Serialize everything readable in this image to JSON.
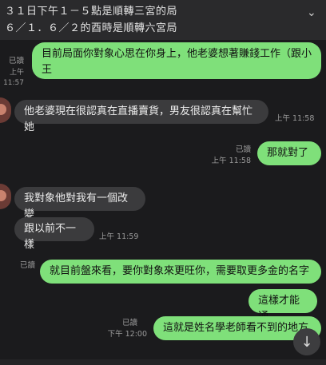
{
  "header": {
    "line1": "３１日下午１－５點是順轉三宮的局",
    "line2": "６／１．６／２的酉時是順轉六宮局"
  },
  "messages": [
    {
      "text": "目前局面你對象心思在你身上，他老婆想著賺錢工作（跟小王",
      "read": "已讀",
      "time": "上午 11:57"
    },
    {
      "text": "他老婆現在很認真在直播賣貨，男友很認真在幫忙她",
      "time": "上午 11:58"
    },
    {
      "text": "那就對了",
      "read": "已讀",
      "time": "上午 11:58"
    },
    {
      "text": "我對象他對我有一個改變"
    },
    {
      "text": "跟以前不一樣",
      "time": "上午 11:59"
    },
    {
      "text": "就目前盤來看，要你對象來更旺你，需要取更多金的名字",
      "read": "已讀"
    },
    {
      "text": "這樣才能通"
    },
    {
      "text": "這就是姓名學老師看不到的地方",
      "read": "已讀",
      "time": "下午 12:00"
    }
  ],
  "icons": {
    "scroll": "arrow-down-icon",
    "collapse": "chevron-down-icon"
  }
}
